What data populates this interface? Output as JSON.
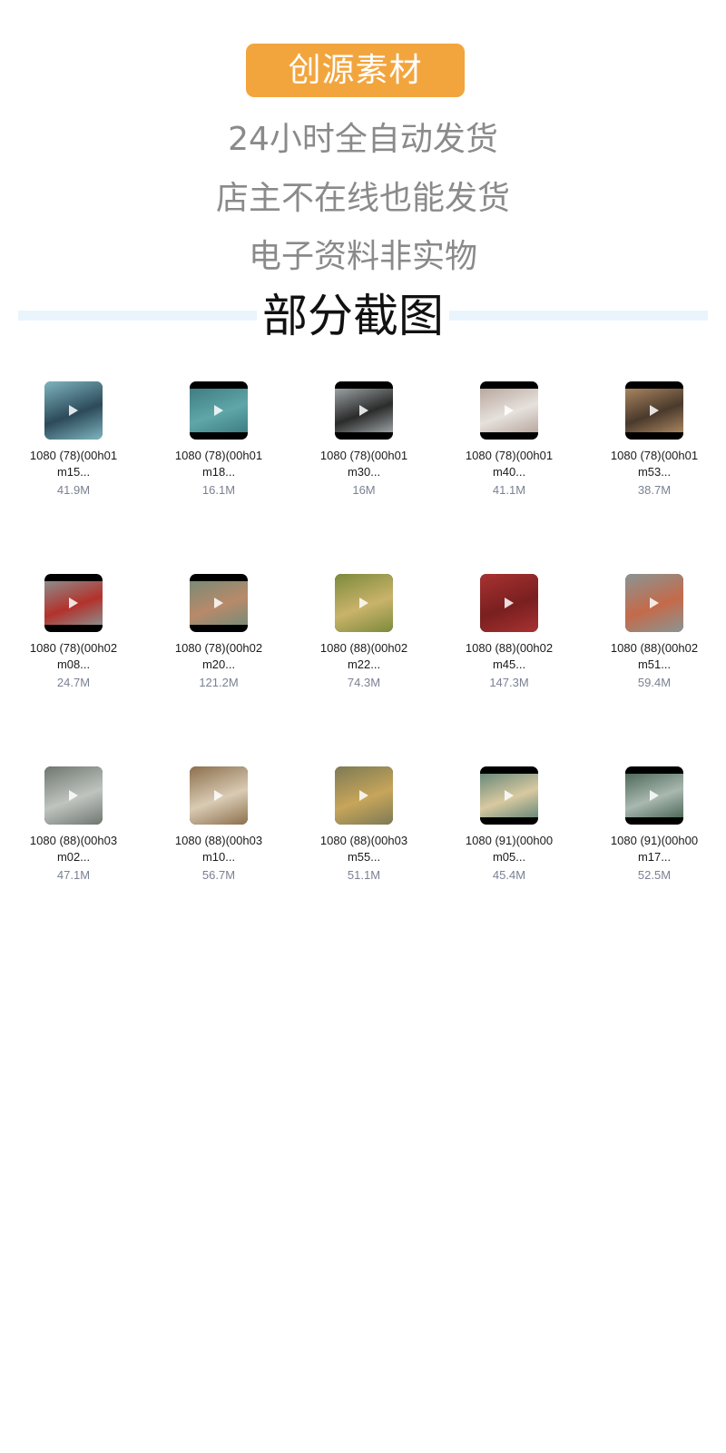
{
  "header": {
    "badge": "创源素材",
    "taglines": [
      "24小时全自动发货",
      "店主不在线也能发货",
      "电子资料非实物"
    ],
    "section_title": "部分截图"
  },
  "files": [
    {
      "line1": "1080 (78)(00h01",
      "line2": "m15...",
      "size": "41.9M",
      "icon": "play-icon",
      "thumb": {
        "bg": "#7fb5bf",
        "accent": "#2c4a5a",
        "letterbox": false
      }
    },
    {
      "line1": "1080 (78)(00h01",
      "line2": "m18...",
      "size": "16.1M",
      "icon": "play-icon",
      "thumb": {
        "bg": "#3f7d83",
        "accent": "#5fa6a9",
        "letterbox": true
      }
    },
    {
      "line1": "1080 (78)(00h01",
      "line2": "m30...",
      "size": "16M",
      "icon": "play-icon",
      "thumb": {
        "bg": "#9aa1a3",
        "accent": "#2b2b2b",
        "letterbox": true
      }
    },
    {
      "line1": "1080 (78)(00h01",
      "line2": "m40...",
      "size": "41.1M",
      "icon": "play-icon",
      "thumb": {
        "bg": "#b9a89f",
        "accent": "#e6e1dc",
        "letterbox": true
      }
    },
    {
      "line1": "1080 (78)(00h01",
      "line2": "m53...",
      "size": "38.7M",
      "icon": "play-icon",
      "thumb": {
        "bg": "#a9845f",
        "accent": "#4a3a2c",
        "letterbox": true
      }
    },
    {
      "line1": "1080 (78)(00h02",
      "line2": "m08...",
      "size": "24.7M",
      "icon": "play-icon",
      "thumb": {
        "bg": "#8c8c8c",
        "accent": "#b3322b",
        "letterbox": true
      }
    },
    {
      "line1": "1080 (78)(00h02",
      "line2": "m20...",
      "size": "121.2M",
      "icon": "play-icon",
      "thumb": {
        "bg": "#7a8a76",
        "accent": "#b88a6a",
        "letterbox": true
      }
    },
    {
      "line1": "1080 (88)(00h02",
      "line2": "m22...",
      "size": "74.3M",
      "icon": "play-icon",
      "thumb": {
        "bg": "#7c8a3c",
        "accent": "#c9b36a",
        "letterbox": false
      }
    },
    {
      "line1": "1080 (88)(00h02",
      "line2": "m45...",
      "size": "147.3M",
      "icon": "play-icon",
      "thumb": {
        "bg": "#a83232",
        "accent": "#7a1f1f",
        "letterbox": false
      }
    },
    {
      "line1": "1080 (88)(00h02",
      "line2": "m51...",
      "size": "59.4M",
      "icon": "play-icon",
      "thumb": {
        "bg": "#8a9593",
        "accent": "#c46a4a",
        "letterbox": false
      }
    },
    {
      "line1": "1080 (88)(00h03",
      "line2": "m02...",
      "size": "47.1M",
      "icon": "play-icon",
      "thumb": {
        "bg": "#6f7670",
        "accent": "#bfc4bf",
        "letterbox": false
      }
    },
    {
      "line1": "1080 (88)(00h03",
      "line2": "m10...",
      "size": "56.7M",
      "icon": "play-icon",
      "thumb": {
        "bg": "#8c6f4c",
        "accent": "#d9cbb4",
        "letterbox": false
      }
    },
    {
      "line1": "1080 (88)(00h03",
      "line2": "m55...",
      "size": "51.1M",
      "icon": "play-icon",
      "thumb": {
        "bg": "#7d7a55",
        "accent": "#c7a55a",
        "letterbox": false
      }
    },
    {
      "line1": "1080 (91)(00h00",
      "line2": "m05...",
      "size": "45.4M",
      "icon": "play-icon",
      "thumb": {
        "bg": "#6a8a7a",
        "accent": "#d8c9a0",
        "letterbox": true
      }
    },
    {
      "line1": "1080 (91)(00h00",
      "line2": "m17...",
      "size": "52.5M",
      "icon": "play-icon",
      "thumb": {
        "bg": "#4f6a5a",
        "accent": "#a9b8b0",
        "letterbox": true
      }
    }
  ]
}
